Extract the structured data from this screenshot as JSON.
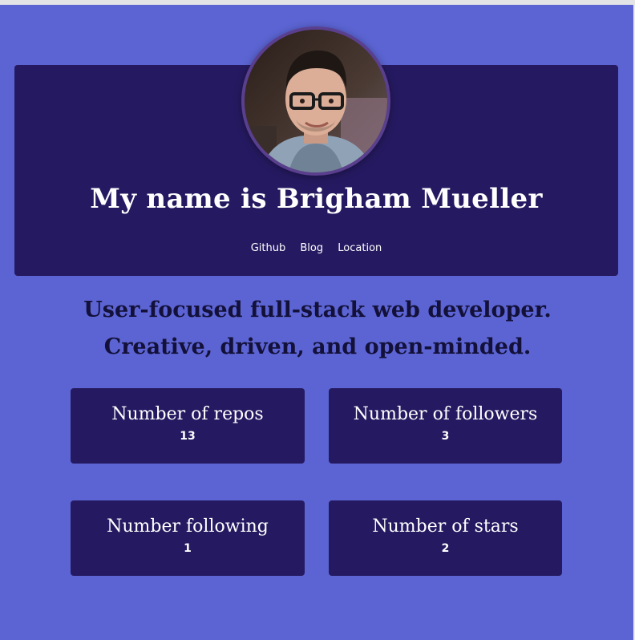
{
  "header": {
    "title": "My name is Brigham Mueller",
    "avatar_icon": "profile-photo",
    "nav": [
      {
        "label": "Github"
      },
      {
        "label": "Blog"
      },
      {
        "label": "Location"
      }
    ]
  },
  "tagline": {
    "line1": "User-focused full-stack web developer.",
    "line2": "Creative, driven, and open-minded."
  },
  "stats": [
    {
      "label": "Number of repos",
      "value": "13"
    },
    {
      "label": "Number of followers",
      "value": "3"
    },
    {
      "label": "Number following",
      "value": "1"
    },
    {
      "label": "Number of stars",
      "value": "2"
    }
  ],
  "colors": {
    "background": "#5b64d2",
    "card": "#251a61",
    "avatar_ring": "#5a3f8e",
    "tagline_text": "#13103a",
    "text": "#ffffff"
  }
}
